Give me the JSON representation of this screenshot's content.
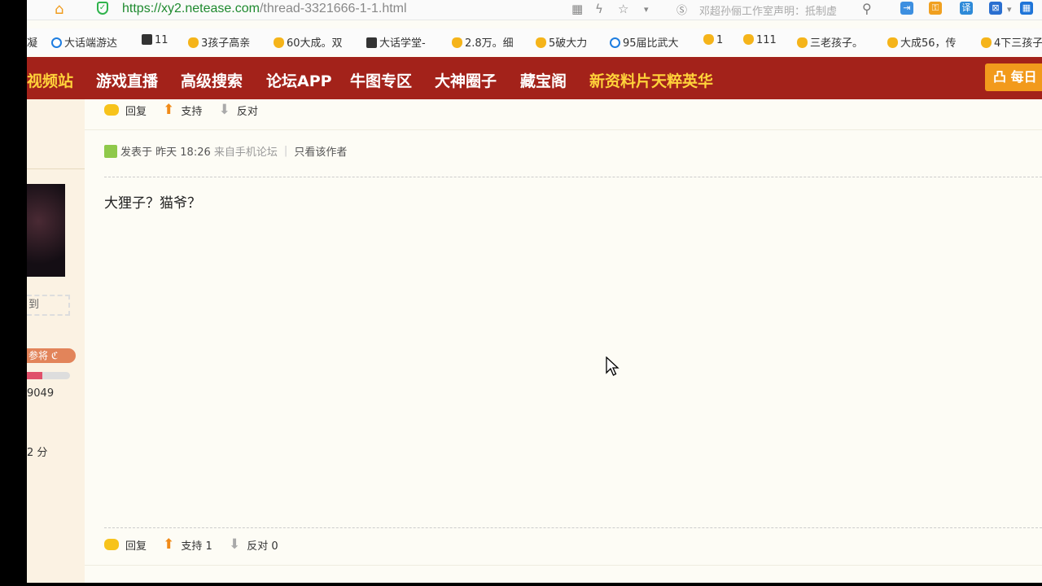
{
  "browser": {
    "url_host": "https://xy2.netease.com",
    "url_path": "/thread-3321666-1-1.html",
    "notice": "邓超孙俪工作室声明：抵制虚"
  },
  "bookmarks": [
    {
      "label": "凝",
      "icon": "none"
    },
    {
      "label": "大话端游达",
      "icon": "ie"
    },
    {
      "label": "11",
      "icon": "game"
    },
    {
      "label": "3孩子高亲",
      "icon": "star"
    },
    {
      "label": "60大成。双",
      "icon": "star"
    },
    {
      "label": "大话学堂-",
      "icon": "game"
    },
    {
      "label": "2.8万。细",
      "icon": "star"
    },
    {
      "label": "5破大力",
      "icon": "star"
    },
    {
      "label": "95届比武大",
      "icon": "ie"
    },
    {
      "label": "1",
      "icon": "star"
    },
    {
      "label": "111",
      "icon": "star"
    },
    {
      "label": "三老孩子。",
      "icon": "star"
    },
    {
      "label": "大成56，传",
      "icon": "star"
    },
    {
      "label": "4下三孩子",
      "icon": "star"
    }
  ],
  "nav": {
    "items": [
      "视频站",
      "游戏直播",
      "高级搜索",
      "论坛APP",
      "牛图专区",
      "大神圈子",
      "藏宝阁",
      "新资料片天粹英华"
    ],
    "daily": "每日"
  },
  "sidebar": {
    "checkin": "到",
    "rank": "参将",
    "stat1": "9049",
    "stat2": "2 分"
  },
  "post": {
    "top_actions": {
      "reply": "回复",
      "support": "支持",
      "oppose": "反对"
    },
    "meta": {
      "posted_prefix": "发表于",
      "time": "昨天 18:26",
      "source": "来自手机论坛",
      "author_only": "只看该作者"
    },
    "body": "大狸子？猫爷？",
    "bottom_actions": {
      "reply": "回复",
      "support": "支持 1",
      "oppose": "反对 0"
    }
  },
  "colors": {
    "nav_bg": "#a3221a",
    "nav_highlight": "#ffd23a",
    "daily_bg": "#f29a1c",
    "page_bg": "#fdfcf5"
  }
}
